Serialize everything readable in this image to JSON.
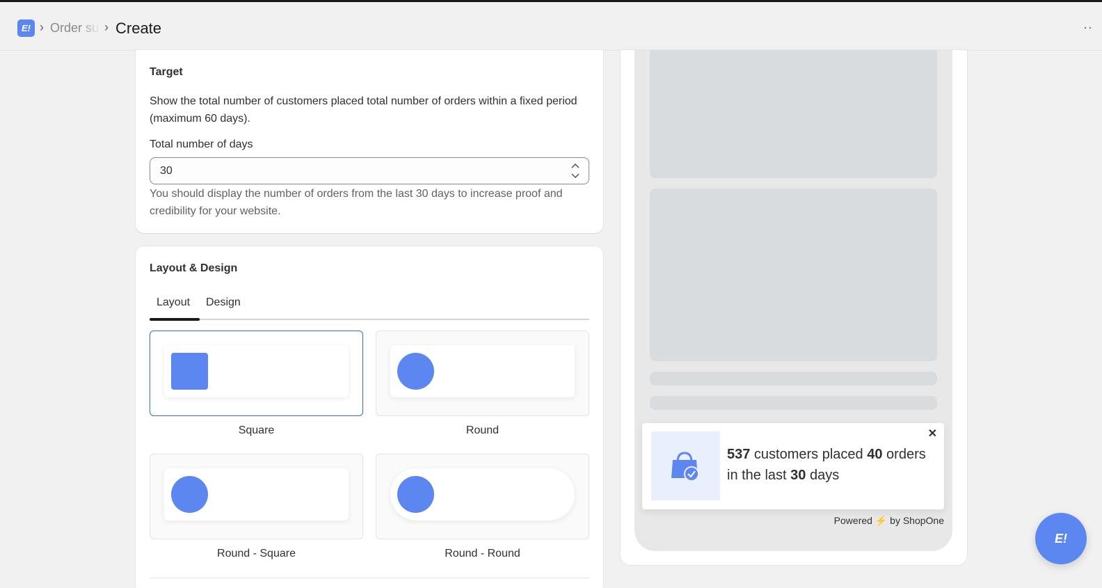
{
  "header": {
    "app_logo_text": "E!",
    "breadcrumb_parent": "Order su",
    "title": "Create",
    "more_label": "··"
  },
  "target": {
    "title": "Target",
    "description": "Show the total number of customers placed total number of orders within a fixed period (maximum 60 days).",
    "days_label": "Total number of days",
    "days_value": "30",
    "help_text": "You should display the number of orders from the last 30 days to increase proof and credibility for your website."
  },
  "layout_design": {
    "title": "Layout & Design",
    "tabs": [
      {
        "label": "Layout",
        "active": true
      },
      {
        "label": "Design",
        "active": false
      }
    ],
    "options": [
      {
        "label": "Square",
        "selected": true
      },
      {
        "label": "Round",
        "selected": false
      },
      {
        "label": "Round - Square",
        "selected": false
      },
      {
        "label": "Round - Round",
        "selected": false
      }
    ]
  },
  "preview": {
    "notification": {
      "customers": "537",
      "t1": " customers placed ",
      "orders": "40",
      "t2": " orders in the last ",
      "days": "30",
      "t3": " days",
      "close_label": "✕",
      "icon": "shopping-bag-check-icon"
    },
    "powered_prefix": "Powered",
    "powered_bolt": "⚡",
    "powered_suffix": "by ShopOne"
  },
  "chat": {
    "label": "E!"
  },
  "colors": {
    "accent": "#5c86f0",
    "selected_border": "#2c6ecb"
  }
}
